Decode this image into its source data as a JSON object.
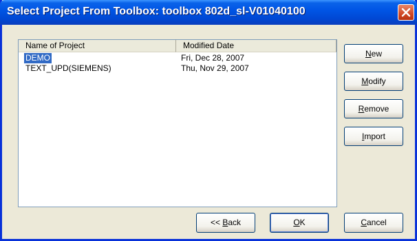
{
  "window": {
    "title": "Select Project  From Toolbox: toolbox 802d_sl-V01040100"
  },
  "list": {
    "columns": [
      "Name of Project",
      "Modified Date"
    ],
    "rows": [
      {
        "name": "DEMO",
        "date": "Fri, Dec 28, 2007",
        "selected": true
      },
      {
        "name": "TEXT_UPD(SIEMENS)",
        "date": "Thu, Nov 29, 2007",
        "selected": false
      }
    ]
  },
  "buttons": {
    "new": {
      "mnemonic": "N",
      "rest": "ew"
    },
    "modify": {
      "mnemonic": "M",
      "rest": "odify"
    },
    "remove": {
      "mnemonic": "R",
      "rest": "emove"
    },
    "import": {
      "mnemonic": "I",
      "rest": "mport"
    },
    "back": {
      "prefix": "<< ",
      "mnemonic": "B",
      "rest": "ack"
    },
    "ok": {
      "mnemonic": "O",
      "rest": "K"
    },
    "cancel": {
      "mnemonic": "C",
      "rest": "ancel"
    }
  },
  "colors": {
    "titlebar": "#0055e5",
    "selection": "#316ac5",
    "dialog_bg": "#ece9d8"
  }
}
